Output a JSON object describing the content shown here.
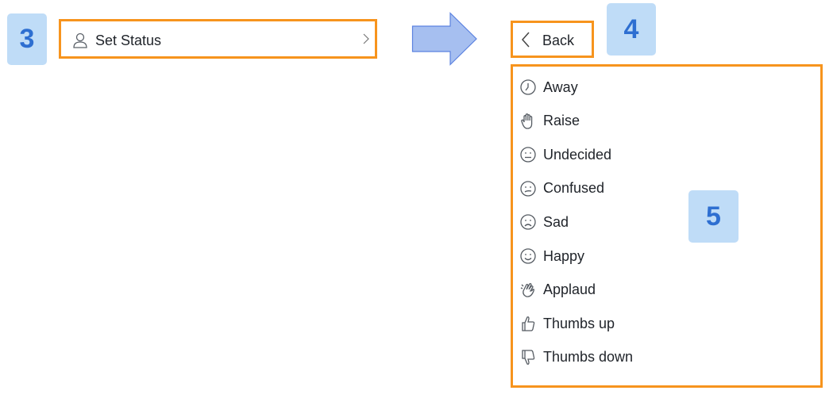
{
  "badges": {
    "step3": "3",
    "step4": "4",
    "step5": "5"
  },
  "set_status": {
    "label": "Set Status",
    "icon": "person-icon",
    "chevron": "chevron-right-icon"
  },
  "arrow": {
    "icon": "arrow-right-icon",
    "fill": "#a6bff0"
  },
  "back": {
    "label": "Back",
    "icon": "chevron-left-icon"
  },
  "statuses": [
    {
      "label": "Away",
      "icon": "clock-icon"
    },
    {
      "label": "Raise",
      "icon": "hand-icon"
    },
    {
      "label": "Undecided",
      "icon": "neutral-face-icon"
    },
    {
      "label": "Confused",
      "icon": "confused-face-icon"
    },
    {
      "label": "Sad",
      "icon": "sad-face-icon"
    },
    {
      "label": "Happy",
      "icon": "happy-face-icon"
    },
    {
      "label": "Applaud",
      "icon": "clap-icon"
    },
    {
      "label": "Thumbs up",
      "icon": "thumbs-up-icon"
    },
    {
      "label": "Thumbs down",
      "icon": "thumbs-down-icon"
    }
  ],
  "colors": {
    "highlight": "#f7941d",
    "badge_bg": "#bfdcf7",
    "badge_text": "#2e6fd1"
  }
}
